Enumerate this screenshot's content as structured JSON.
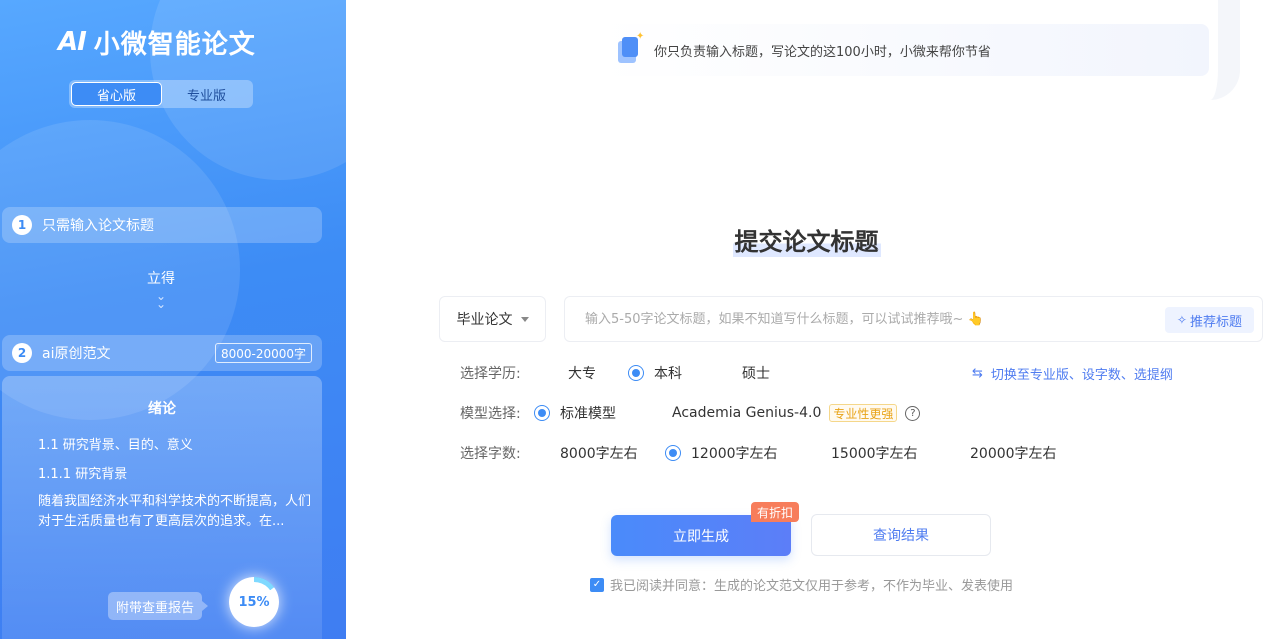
{
  "sidebar": {
    "logo_mark": "AI",
    "logo_text": "小微智能论文",
    "versions": [
      {
        "label": "省心版",
        "active": true
      },
      {
        "label": "专业版",
        "active": false
      }
    ],
    "step1": {
      "num": "1",
      "label": "只需输入论文标题"
    },
    "lide": "立得",
    "step2": {
      "num": "2",
      "label": "ai原创范文",
      "range": "8000-20000字"
    },
    "preview": {
      "heading": "绪论",
      "line1": "1.1 研究背景、目的、意义",
      "line2": "1.1.1 研究背景",
      "paragraph": "随着我国经济水平和科学技术的不断提高，人们对于生活质量也有了更高层次的追求。在..."
    },
    "report_label": "附带查重报告",
    "report_percent": "15%",
    "report_value": 15
  },
  "banner": {
    "text": "你只负责输入标题，写论文的这100小时，小微来帮你节省"
  },
  "main": {
    "title": "提交论文标题",
    "type_select": "毕业论文",
    "title_input_placeholder": "输入5-50字论文标题，如果不知道写什么标题，可以试试推荐哦~ 👆",
    "recommend_label": "推荐标题",
    "education": {
      "label": "选择学历:",
      "options": [
        "大专",
        "本科",
        "硕士"
      ],
      "selected": 1
    },
    "switch_link": "切换至专业版、设字数、选提纲",
    "model": {
      "label": "模型选择:",
      "options": [
        "标准模型",
        "Academia Genius-4.0"
      ],
      "selected": 0,
      "pro_badge": "专业性更强"
    },
    "words": {
      "label": "选择字数:",
      "options": [
        "8000字左右",
        "12000字左右",
        "15000字左右",
        "20000字左右"
      ],
      "selected": 1
    },
    "generate_label": "立即生成",
    "discount_label": "有折扣",
    "query_label": "查询结果",
    "agree_text": "我已阅读并同意：生成的论文范文仅用于参考，不作为毕业、发表使用"
  },
  "colors": {
    "accent": "#3d8cf5",
    "sidebar_bg": "#4a90f6",
    "discount": "#f77d5b",
    "pro_badge": "#e8a317"
  }
}
